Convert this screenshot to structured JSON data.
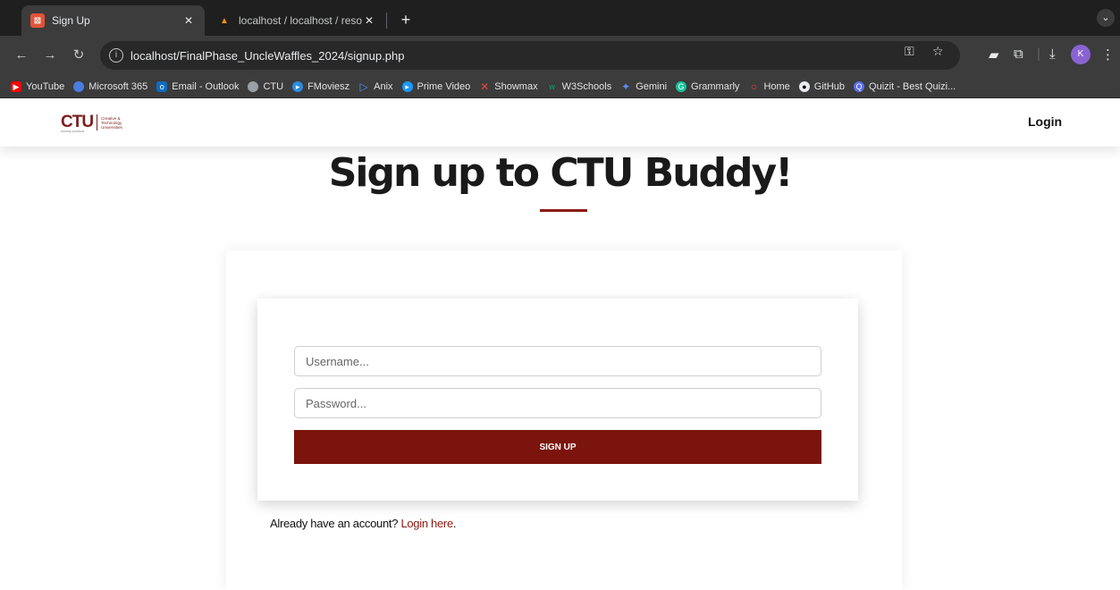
{
  "browser": {
    "tabs": [
      {
        "title": "Sign Up",
        "active": true,
        "favicon_color": "#e1543a"
      },
      {
        "title": "localhost / localhost / resourc",
        "active": false,
        "favicon_color": "#f29111"
      }
    ],
    "tabs_menu_icon": "chevron-down-icon",
    "url": "localhost/FinalPhase_UncleWaffles_2024/signup.php",
    "profile_initial": "K",
    "bookmarks": [
      {
        "label": "YouTube",
        "color": "#ff0000"
      },
      {
        "label": "Microsoft 365",
        "color": "#4a7de0"
      },
      {
        "label": "Email - Outlook",
        "color": "#0f6cbd"
      },
      {
        "label": "CTU",
        "color": "#9aa0a6"
      },
      {
        "label": "FMoviesz",
        "color": "#2b8de3"
      },
      {
        "label": "Anix",
        "color": "#4f8ef7"
      },
      {
        "label": "Prime Video",
        "color": "#1a98ff"
      },
      {
        "label": "Showmax",
        "color": "#e8463d"
      },
      {
        "label": "W3Schools",
        "color": "#04aa6d"
      },
      {
        "label": "Gemini",
        "color": "#5b8def"
      },
      {
        "label": "Grammarly",
        "color": "#15c39a"
      },
      {
        "label": "Home",
        "color": "#e0483e"
      },
      {
        "label": "GitHub",
        "color": "#e8eaed"
      },
      {
        "label": "Quizit - Best Quizi...",
        "color": "#5b6cf2"
      }
    ]
  },
  "site": {
    "logo": {
      "brand": "CTU",
      "subtitle_lines": [
        "Creative &",
        "Technology",
        "Universities"
      ],
      "tagline": "training solutions"
    },
    "nav_login": "Login"
  },
  "page": {
    "heading": "Sign up to CTU Buddy!",
    "accent_color": "#7a140d",
    "form": {
      "username_placeholder": "Username...",
      "password_placeholder": "Password...",
      "submit_label": "SIGN UP"
    },
    "footer_text": "Already have an account? ",
    "footer_link": "Login here",
    "footer_end": "."
  }
}
